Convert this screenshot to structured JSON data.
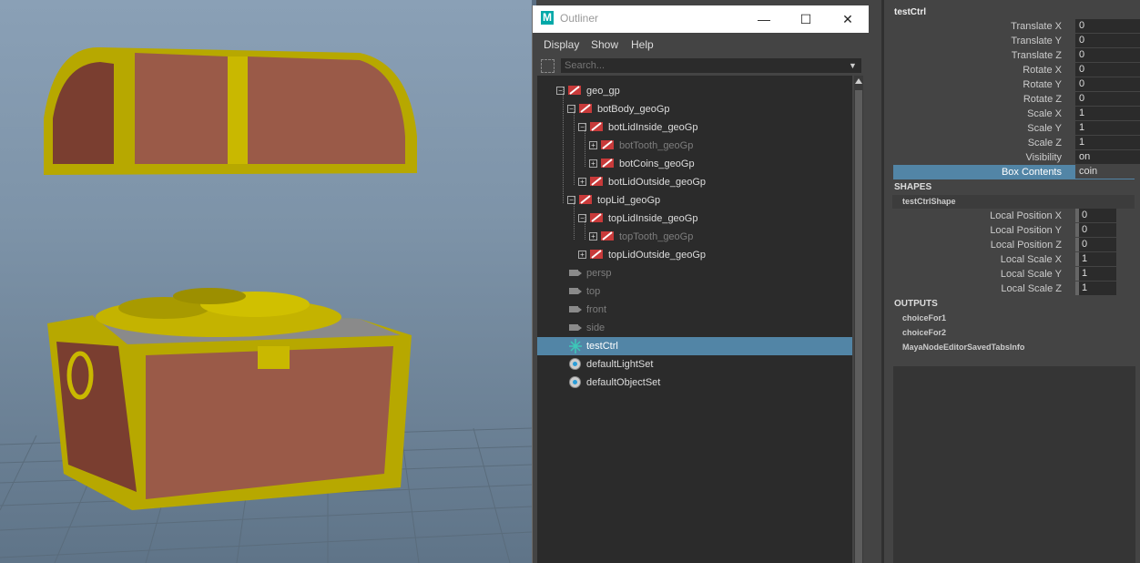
{
  "outliner": {
    "title": "Outliner",
    "logo": "M",
    "window_buttons": {
      "minimize": "—",
      "maximize": "☐",
      "close": "✕"
    },
    "menu": [
      "Display",
      "Show",
      "Help"
    ],
    "search_placeholder": "Search...",
    "tree": [
      {
        "label": "geo_gp",
        "depth": 0,
        "expander": "minus",
        "icon": "group",
        "state": "normal"
      },
      {
        "label": "botBody_geoGp",
        "depth": 1,
        "expander": "minus",
        "icon": "group",
        "state": "normal"
      },
      {
        "label": "botLidInside_geoGp",
        "depth": 2,
        "expander": "minus",
        "icon": "group",
        "state": "normal"
      },
      {
        "label": "botTooth_geoGp",
        "depth": 3,
        "expander": "plus",
        "icon": "group",
        "state": "dim"
      },
      {
        "label": "botCoins_geoGp",
        "depth": 3,
        "expander": "plus",
        "icon": "group",
        "state": "normal"
      },
      {
        "label": "botLidOutside_geoGp",
        "depth": 2,
        "expander": "plus",
        "icon": "group",
        "state": "normal"
      },
      {
        "label": "topLid_geoGp",
        "depth": 1,
        "expander": "minus",
        "icon": "group",
        "state": "normal"
      },
      {
        "label": "topLidInside_geoGp",
        "depth": 2,
        "expander": "minus",
        "icon": "group",
        "state": "normal"
      },
      {
        "label": "topTooth_geoGp",
        "depth": 3,
        "expander": "plus",
        "icon": "group",
        "state": "dim"
      },
      {
        "label": "topLidOutside_geoGp",
        "depth": 2,
        "expander": "plus",
        "icon": "group",
        "state": "normal"
      },
      {
        "label": "persp",
        "depth": 0,
        "expander": "none",
        "icon": "camera",
        "state": "dim"
      },
      {
        "label": "top",
        "depth": 0,
        "expander": "none",
        "icon": "camera",
        "state": "dim"
      },
      {
        "label": "front",
        "depth": 0,
        "expander": "none",
        "icon": "camera",
        "state": "dim"
      },
      {
        "label": "side",
        "depth": 0,
        "expander": "none",
        "icon": "camera",
        "state": "dim"
      },
      {
        "label": "testCtrl",
        "depth": 0,
        "expander": "none",
        "icon": "locator",
        "state": "selected"
      },
      {
        "label": "defaultLightSet",
        "depth": 0,
        "expander": "none",
        "icon": "set",
        "state": "normal"
      },
      {
        "label": "defaultObjectSet",
        "depth": 0,
        "expander": "none",
        "icon": "set",
        "state": "normal"
      }
    ]
  },
  "attributes": {
    "node_name": "testCtrl",
    "transform": [
      {
        "label": "Translate X",
        "value": "0"
      },
      {
        "label": "Translate Y",
        "value": "0"
      },
      {
        "label": "Translate Z",
        "value": "0"
      },
      {
        "label": "Rotate X",
        "value": "0"
      },
      {
        "label": "Rotate Y",
        "value": "0"
      },
      {
        "label": "Rotate Z",
        "value": "0"
      },
      {
        "label": "Scale X",
        "value": "1"
      },
      {
        "label": "Scale Y",
        "value": "1"
      },
      {
        "label": "Scale Z",
        "value": "1"
      },
      {
        "label": "Visibility",
        "value": "on"
      },
      {
        "label": "Box Contents",
        "value": "coin",
        "highlighted": true
      }
    ],
    "shapes_header": "SHAPES",
    "shape_name": "testCtrlShape",
    "shape_attrs": [
      {
        "label": "Local Position X",
        "value": "0"
      },
      {
        "label": "Local Position Y",
        "value": "0"
      },
      {
        "label": "Local Position Z",
        "value": "0"
      },
      {
        "label": "Local Scale X",
        "value": "1"
      },
      {
        "label": "Local Scale Y",
        "value": "1"
      },
      {
        "label": "Local Scale Z",
        "value": "1"
      }
    ],
    "outputs_header": "OUTPUTS",
    "outputs": [
      "choiceFor1",
      "choiceFor2",
      "MayaNodeEditorSavedTabsInfo"
    ]
  },
  "colors": {
    "selection": "#5285a6",
    "panel_bg": "#444444",
    "field_bg": "#2b2b2b",
    "chest_wood": "#9a5a48",
    "chest_gold": "#b7a800",
    "viewport_sky": "#7d93a8"
  }
}
